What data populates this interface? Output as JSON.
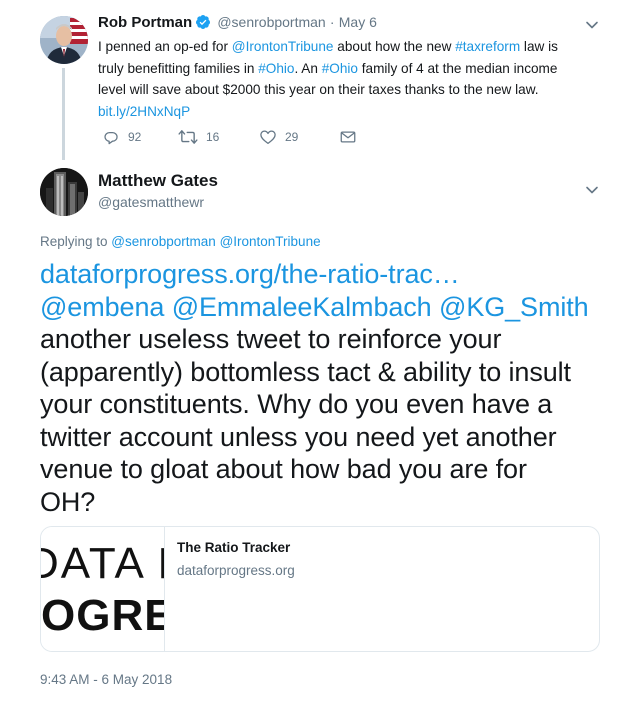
{
  "parent_tweet": {
    "author_name": "Rob Portman",
    "handle": "@senrobportman",
    "separator": "·",
    "date": "May 6",
    "verified_icon": "verified-badge-icon",
    "text": {
      "l1_a": "I penned an op-ed for ",
      "l1_mention": "@IrontonTribune",
      "l1_b": " about how the new ",
      "l1_hashtag": "#taxreform",
      "l1_c": " law is",
      "l2_a": "truly benefitting families in ",
      "l2_hashtag": "#Ohio",
      "l2_b": ". An ",
      "l2_hashtag2": "#Ohio",
      "l2_c": " family of 4 at the median income",
      "l3": "level will save about $2000 this year on their taxes thanks to the new law.",
      "link": "bit.ly/2HNxNqP"
    },
    "actions": {
      "reply_count": "92",
      "retweet_count": "16",
      "like_count": "29"
    }
  },
  "reply_tweet": {
    "author_name": "Matthew Gates",
    "handle": "@gatesmatthewr",
    "replying_prefix": "Replying to ",
    "replying_to_1": "@senrobportman",
    "replying_to_2": "@IrontonTribune",
    "text": {
      "link": "dataforprogress.org/the-ratio-trac…",
      "mention1": "@embena",
      "mention2": "@EmmaleeKalmbach",
      "mention3": "@KG_Smith",
      "l3": "another useless tweet to reinforce your",
      "l4": "(apparently) bottomless tact & ability to insult",
      "l5": "your constituents.  Why do you even have a",
      "l6": "twitter account unless you need yet another",
      "l7": "venue to gloat about how bad you are for",
      "l8": "OH?"
    },
    "card": {
      "image_text_1": "DATA F",
      "image_text_2": "OGRE",
      "title": "The Ratio Tracker",
      "domain": "dataforprogress.org"
    },
    "timestamp": "9:43 AM - 6 May 2018"
  },
  "colors": {
    "link": "#1b95e0",
    "muted": "#657786",
    "text": "#14171a",
    "border": "#e1e8ed",
    "verified": "#1da1f2"
  }
}
